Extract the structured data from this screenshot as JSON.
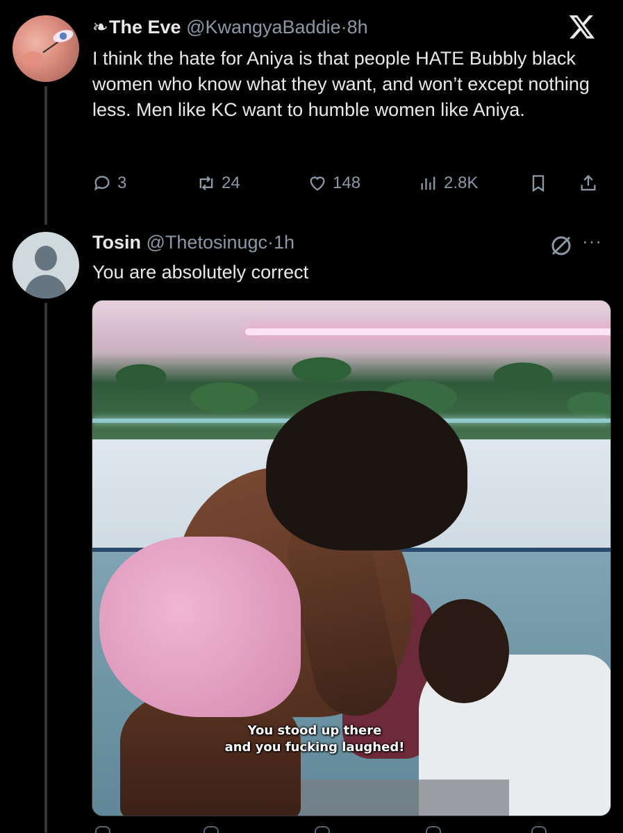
{
  "tweet1": {
    "name": "The Eve",
    "name_icon": "butterfly-icon",
    "handle": "@KwangyaBaddie",
    "separator": "·",
    "time": "8h",
    "text": "I think the hate for Aniya is that people HATE Bubbly black women who know what they want, and won’t except nothing less. Men like KC want to humble women like Aniya.",
    "replies": "3",
    "retweets": "24",
    "likes": "148",
    "views": "2.8K"
  },
  "tweet2": {
    "name": "Tosin",
    "handle": "@Thetosinugc",
    "separator": "·",
    "time": "1h",
    "text": "You are absolutely correct",
    "more_label": "···",
    "media": {
      "subtitle_line1": "You stood up there",
      "subtitle_line2": "and you fucking laughed!"
    }
  },
  "app": {
    "logo": "x-logo-icon"
  },
  "colors": {
    "background": "#000000",
    "text": "#e7e9ea",
    "muted": "#8b98a5",
    "thread_line": "#333639"
  }
}
